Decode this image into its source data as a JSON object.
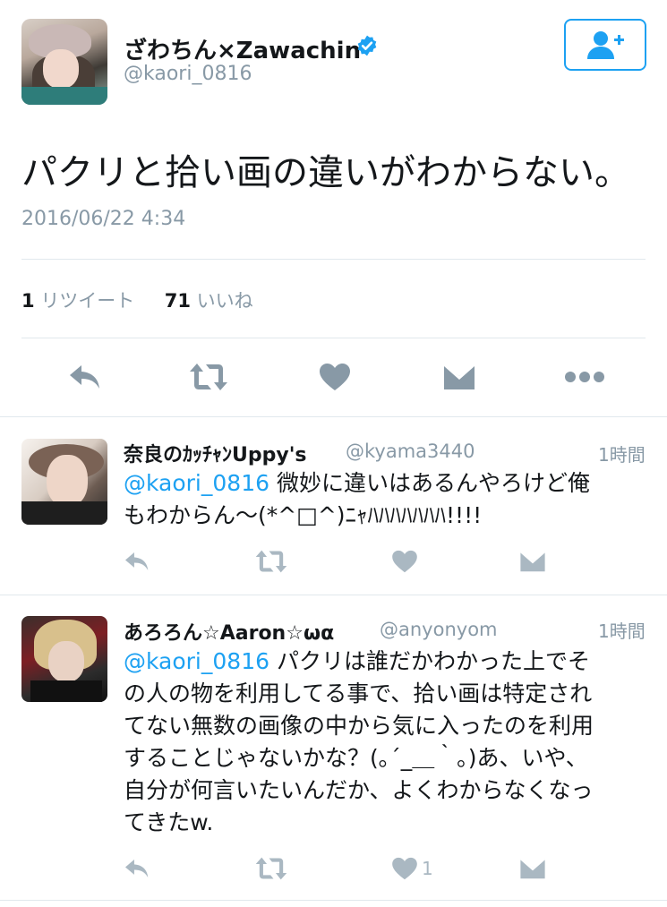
{
  "main_tweet": {
    "display_name": "ざわちん×Zawachin",
    "handle": "@kaori_0816",
    "text": "パクリと拾い画の違いがわからない。",
    "timestamp": "2016/06/22 4:34",
    "stats": {
      "retweets_count": "1",
      "retweets_label": "リツイート",
      "likes_count": "71",
      "likes_label": "いいね"
    }
  },
  "replies": [
    {
      "display_name": "奈良のｶｯﾁｬﾝUppy's",
      "handle": "@kyama3440",
      "time": "1時間",
      "mention": "@kaori_0816",
      "text_line1": " 微妙に違いはあるんやろけど俺",
      "text_line2": "もわからん〜(*^□^)ﾆｬﾊﾊﾊﾊﾊﾊﾊ!!!!"
    },
    {
      "display_name": "あろろん☆Aaron☆ωα",
      "handle": "@anyonyom",
      "time": "1時間",
      "mention": "@kaori_0816",
      "text_line1": " パクリは誰だかわかった上でそ",
      "text_line2": "の人の物を利用してる事で、拾い画は特定され",
      "text_line3": "てない無数の画像の中から気に入ったのを利用",
      "text_line4": "することじゃないかな？(｡´_＿｀｡)あ、いや、",
      "text_line5": "自分が何言いたいんだか、よくわからなくなっ",
      "text_line6": "てきたw.",
      "like_count": "1"
    }
  ],
  "colors": {
    "accent": "#1da1f2",
    "muted": "#8899a6",
    "icon": "#aab8c2",
    "action_icon": "#8899a6"
  }
}
